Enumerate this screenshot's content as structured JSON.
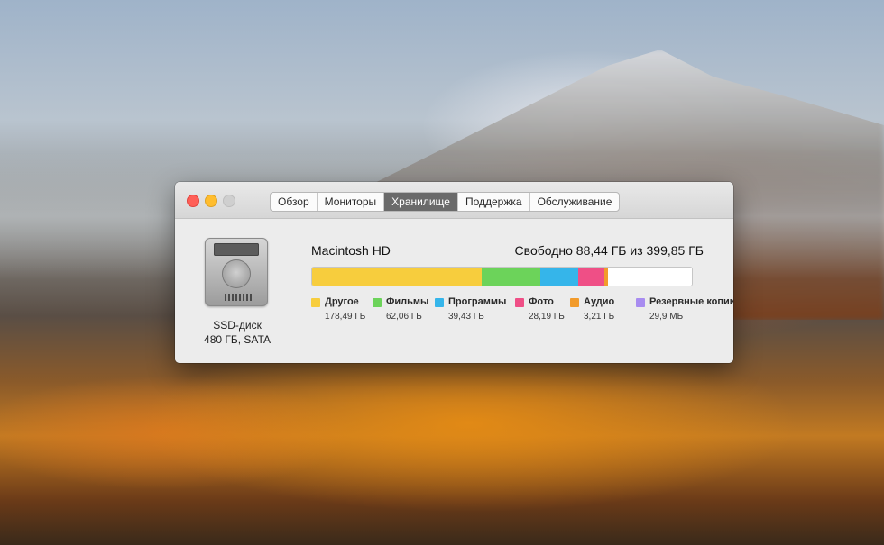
{
  "window": {
    "tabs": [
      {
        "label": "Обзор",
        "active": false
      },
      {
        "label": "Мониторы",
        "active": false
      },
      {
        "label": "Хранилище",
        "active": true
      },
      {
        "label": "Поддержка",
        "active": false
      },
      {
        "label": "Обслуживание",
        "active": false
      }
    ]
  },
  "disk": {
    "icon": "hard-drive-icon",
    "type_label": "SSD-диск",
    "spec_label": "480 ГБ, SATA"
  },
  "volume": {
    "name": "Macintosh HD",
    "free_label": "Свободно 88,44 ГБ из 399,85 ГБ"
  },
  "storage_usage": {
    "capacity_gb": 399.85,
    "free_gb": 88.44,
    "categories": [
      {
        "name": "Другое",
        "size_label": "178,49 ГБ",
        "size_gb": 178.49,
        "color": "#f7cd3d"
      },
      {
        "name": "Фильмы",
        "size_label": "62,06 ГБ",
        "size_gb": 62.06,
        "color": "#6cd35a"
      },
      {
        "name": "Программы",
        "size_label": "39,43 ГБ",
        "size_gb": 39.43,
        "color": "#35b5ea"
      },
      {
        "name": "Фото",
        "size_label": "28,19 ГБ",
        "size_gb": 28.19,
        "color": "#ef4f86"
      },
      {
        "name": "Аудио",
        "size_label": "3,21 ГБ",
        "size_gb": 3.21,
        "color": "#f29b2b"
      },
      {
        "name": "Резервные копии",
        "size_label": "29,9 МБ",
        "size_gb": 0.0299,
        "color": "#a88cf0"
      }
    ]
  }
}
